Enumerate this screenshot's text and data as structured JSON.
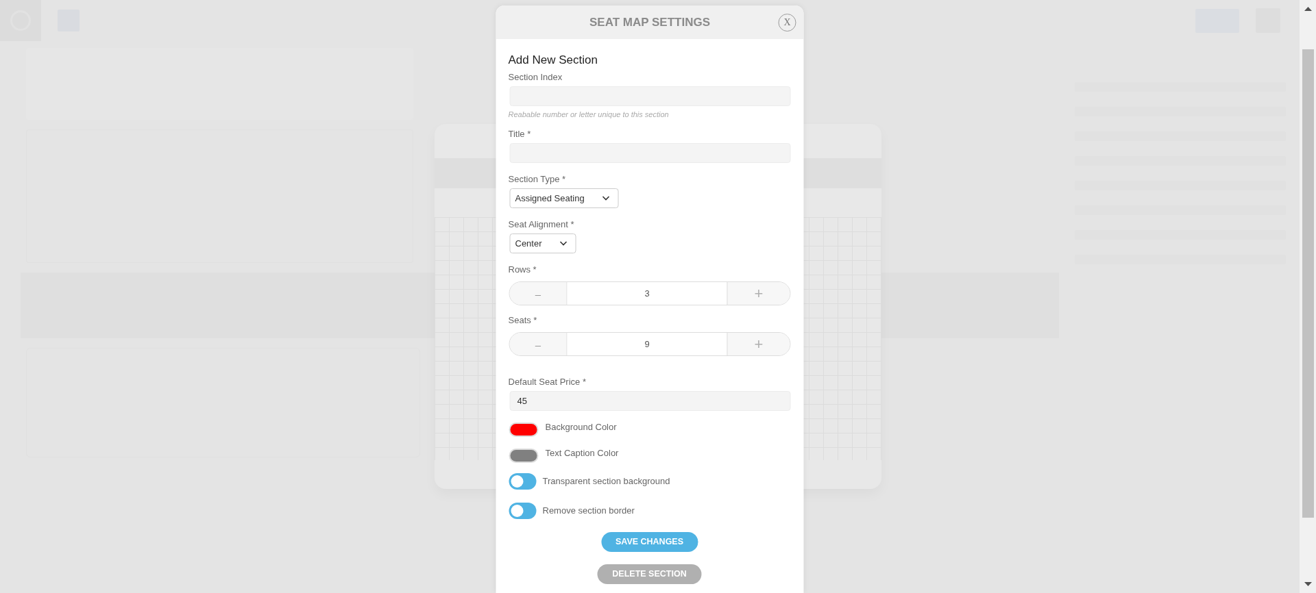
{
  "dialog": {
    "title": "SEAT MAP SETTINGS",
    "close_label": "X",
    "heading": "Add New Section",
    "fields": [
      {
        "kind": "text",
        "label": "Section Index",
        "help": "Reabable number or letter unique to this section"
      },
      {
        "kind": "text",
        "label": "Title *"
      },
      {
        "kind": "select",
        "label": "Section Type *",
        "value": "Assigned Seating"
      },
      {
        "kind": "select",
        "label": "Seat Alignment *",
        "value": "Center"
      },
      {
        "kind": "stepper",
        "label": "Rows *",
        "value": "3",
        "minus": "–",
        "plus": "+"
      },
      {
        "kind": "stepper",
        "label": "Seats *",
        "value": "9",
        "minus": "–",
        "plus": "+"
      },
      {
        "kind": "text",
        "label": "Default Seat Price *",
        "value": "45"
      },
      {
        "kind": "color",
        "label": "Background Color",
        "color": "#ff0000"
      },
      {
        "kind": "color",
        "label": "Text Caption Color",
        "color": "#808080"
      },
      {
        "kind": "toggle",
        "label": "Transparent section background",
        "on": false
      },
      {
        "kind": "toggle",
        "label": "Remove section border",
        "on": false
      }
    ],
    "buttons": [
      {
        "kind": "primary",
        "label": "SAVE CHANGES"
      },
      {
        "kind": "secondary",
        "label": "DELETE SECTION"
      }
    ]
  }
}
